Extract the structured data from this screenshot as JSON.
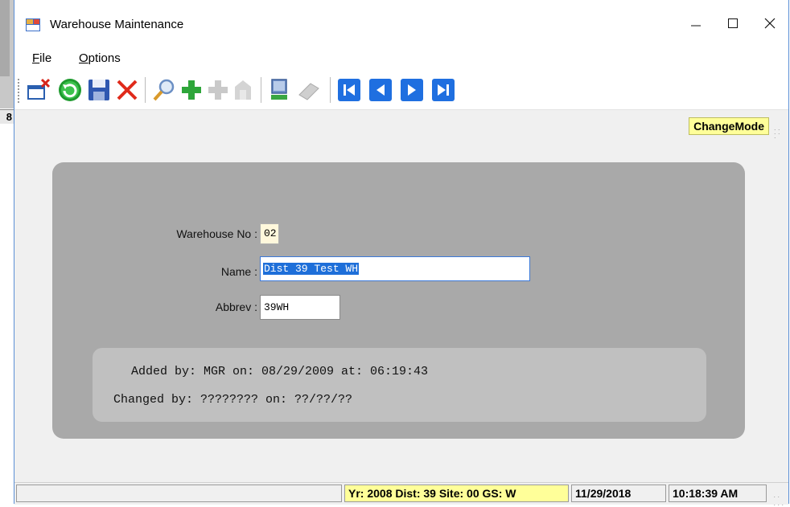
{
  "window": {
    "title": "Warehouse Maintenance"
  },
  "background": {
    "edge_text": "8"
  },
  "menu": [
    {
      "label": "File",
      "accel": "F",
      "rest": "ile"
    },
    {
      "label": "Options",
      "accel": "O",
      "rest": "ptions"
    }
  ],
  "toolbar_icons": [
    "new-window-close-icon",
    "refresh-icon",
    "save-icon",
    "delete-icon",
    "find-icon",
    "add-icon",
    "add-disabled-icon",
    "upload-disabled-icon",
    "computer-icon",
    "eraser-disabled-icon",
    "first-record-icon",
    "previous-record-icon",
    "next-record-icon",
    "last-record-icon"
  ],
  "mode": "ChangeMode",
  "form": {
    "warehouse_no_label": "Warehouse No :",
    "warehouse_no": "02",
    "name_label": "Name :",
    "name": "Dist 39 Test WH",
    "abbrev_label": "Abbrev :",
    "abbrev": "39WH"
  },
  "audit": {
    "added": "Added by: MGR on: 08/29/2009 at: 06:19:43",
    "changed": "Changed by: ???????? on: ??/??/??"
  },
  "status": {
    "left": "",
    "context": "Yr: 2008 Dist: 39 Site: 00 GS: W",
    "date": "11/29/2018",
    "time": "10:18:39 AM"
  },
  "colors": {
    "panel": "#a9a9a9",
    "audit": "#c0c0c0",
    "badge": "#ffff99",
    "selection": "#1e6fd9"
  }
}
